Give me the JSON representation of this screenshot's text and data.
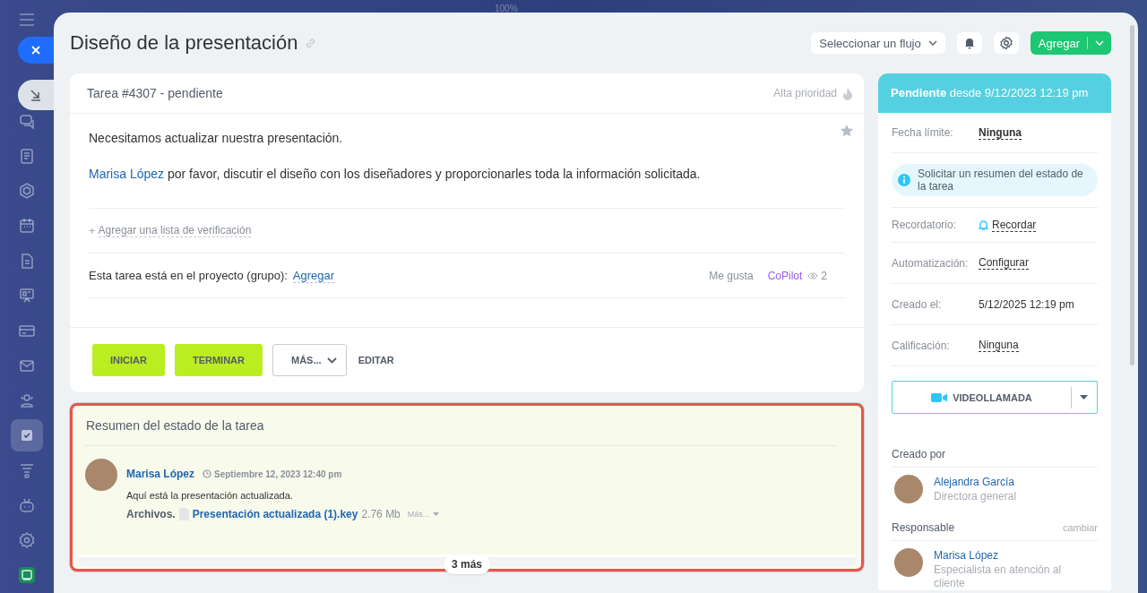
{
  "top_bar": {
    "zoom": "100%"
  },
  "sidebar": {
    "items": [
      {
        "selected": false
      },
      {
        "selected": false
      },
      {
        "selected": false
      },
      {
        "selected": false
      },
      {
        "selected": false
      },
      {
        "selected": false
      },
      {
        "selected": false
      },
      {
        "selected": false
      },
      {
        "selected": false
      },
      {
        "selected": true
      },
      {
        "selected": false
      },
      {
        "selected": false
      },
      {
        "selected": false
      },
      {
        "selected": false
      }
    ]
  },
  "header": {
    "title": "Diseño de la presentación",
    "flow_select": "Seleccionar un flujo",
    "add_button": "Agregar"
  },
  "task": {
    "heading": "Tarea #4307 - pendiente",
    "priority": "Alta prioridad",
    "favorite": false,
    "description": "Necesitamos actualizar nuestra presentación.",
    "mention": "Marisa López",
    "request": "por favor, discutir el diseño con los diseñadores y proporcionarles toda la información solicitada.",
    "checklist_plus": "+",
    "checklist_link": "Agregar una lista de verificación",
    "project_label": "Esta tarea está en el proyecto (grupo):",
    "project_link": "Agregar",
    "like": "Me gusta",
    "copilot": "CoPilot",
    "views": "2",
    "actions": [
      {
        "label": "INICIAR",
        "kind": "primary"
      },
      {
        "label": "TERMINAR",
        "kind": "primary"
      },
      {
        "label": "MÁS...",
        "kind": "menu"
      },
      {
        "label": "EDITAR",
        "kind": "link"
      }
    ]
  },
  "summary": {
    "title": "Resumen del estado de la tarea",
    "comment": {
      "author": "Marisa López",
      "time": "Septiembre 12, 2023 12:40 pm",
      "text": "Aquí está la presentación actualizada.",
      "files_label": "Archivos.",
      "file_name": "Presentación actualizada (1).key",
      "file_size": "2.76 Mb",
      "more": "Más..."
    },
    "more_count": "3 más"
  },
  "details": {
    "status": "**Pendiente** desde 9/12/2023 12:19 pm",
    "rows": [
      {
        "kind": "deadline",
        "label": "Fecha límite:",
        "value": "Ninguna"
      },
      {
        "kind": "info",
        "value": "Solicitar un resumen del estado de la tarea"
      },
      {
        "kind": "reminder",
        "label": "Recordatorio:",
        "value": "Recordar"
      },
      {
        "kind": "link",
        "label": "Automatización:",
        "value": "Configurar"
      },
      {
        "kind": "text",
        "label": "Creado el:",
        "value": "5/12/2025 12:19 pm"
      },
      {
        "kind": "link",
        "label": "Calificación:",
        "value": "Ninguna"
      }
    ],
    "video_button": "VIDEOLLAMADA",
    "people": [
      {
        "heading": "Creado por",
        "name": "Alejandra García",
        "role": "Directora general"
      },
      {
        "heading": "Responsable",
        "action": "cambiar",
        "name": "Marisa López",
        "role": "Especialista en atención al cliente"
      }
    ]
  }
}
